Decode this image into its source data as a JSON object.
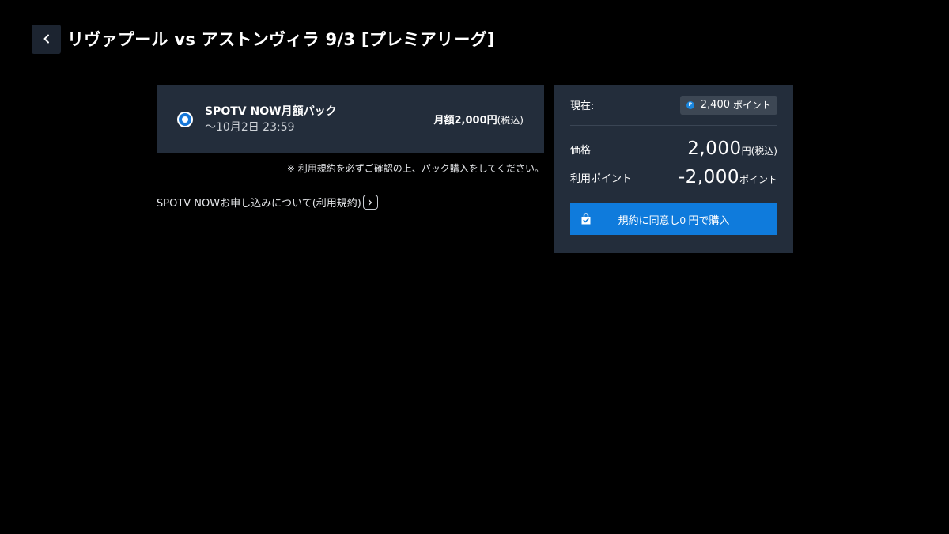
{
  "header": {
    "title": "リヴァプール vs アストンヴィラ 9/3 [プレミアリーグ]"
  },
  "plan": {
    "name": "SPOTV NOW月額パック",
    "period": "〜10月2日 23:59",
    "price": "月額2,000円",
    "price_tax": "(税込)",
    "selected": true
  },
  "notice": "※ 利用規約を必ずご確認の上、パック購入をしてください。",
  "terms_link": "SPOTV NOWお申し込みについて(利用規約)",
  "panel": {
    "current_label": "現在:",
    "current_points": "2,400",
    "current_points_unit": "ポイント",
    "price_label": "価格",
    "price_value": "2,000",
    "price_suffix": "円(税込)",
    "use_label": "利用ポイント",
    "use_value": "-2,000",
    "use_suffix": "ポイント",
    "buy_button": "規約に同意し0 円で購入"
  },
  "colors": {
    "background": "#000000",
    "card": "#232d3b",
    "accent": "#0f7bdc"
  }
}
